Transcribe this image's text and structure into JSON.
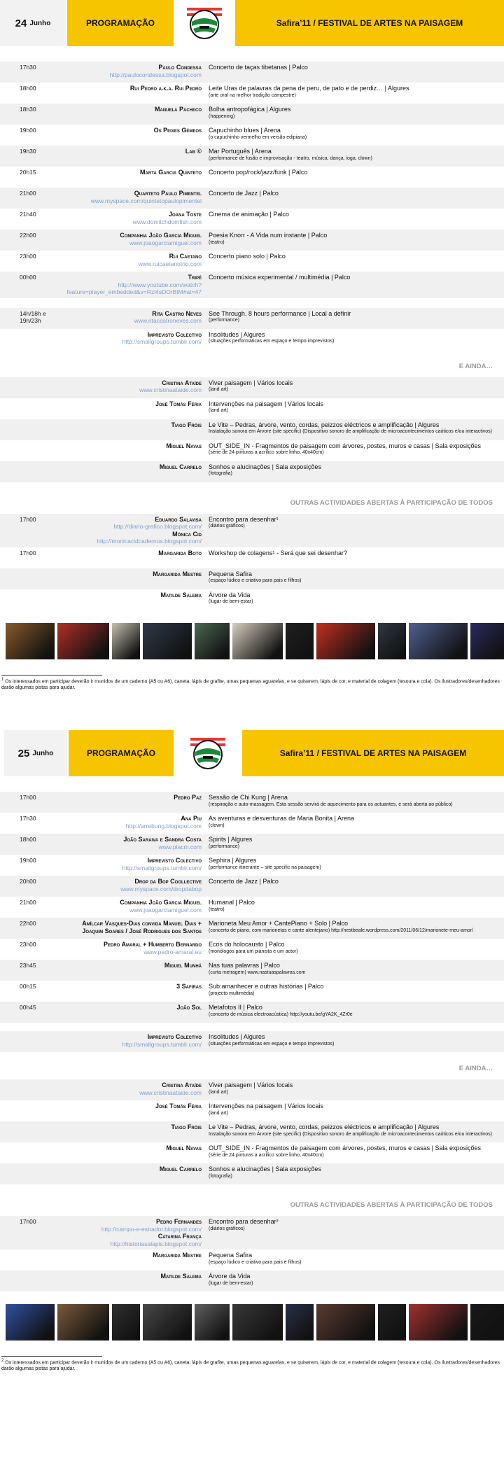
{
  "day1": {
    "date_num": "24",
    "date_month": "Junho",
    "programacao": "PROGRAMAÇÃO",
    "festival_title": "Safira’11 / FESTIVAL DE ARTES NA PAISAGEM",
    "schedule": [
      {
        "time": "17h30",
        "name": "Paulo Condessa",
        "link": "http://paulocondessa.blogspot.com",
        "act": "Concerto de taças tibetanas | Palco",
        "sub": ""
      },
      {
        "time": "18h00",
        "name": "Rui Pedro a.k.a. Rui Pedro",
        "link": "",
        "act": "Leite Uras de palavras da pena de peru, de pato e de perdiz… | Algures",
        "sub": "(arte oral na melhor tradição campestre)"
      },
      {
        "time": "18h30",
        "name": "Manuela Pacheco",
        "link": "",
        "act": "Bolha antropofágica | Algures",
        "sub": "(happening)"
      },
      {
        "time": "19h00",
        "name": "Os Peixes Gémeos",
        "link": "",
        "act": "Capuchinho blues | Arena",
        "sub": "(o capuchinho vermelho em versão edipiana)"
      },
      {
        "time": "19h30",
        "name": "Lab ©",
        "link": "",
        "act": "Mar Português | Arena",
        "sub": "(performance de fusão e improvisação - teatro, música, dança, ioga, clown)"
      },
      {
        "time": "20h15",
        "name": "Marta Garcia Quinteto",
        "link": "",
        "act": "Concerto pop/rock/jazz/funk | Palco",
        "sub": ""
      },
      {
        "time": "21h00",
        "name": "Quarteto Paulo Pimentel",
        "link": "www.myspace.com/quintetopaulopimentel",
        "act": "Concerto de Jazz | Palco",
        "sub": ""
      },
      {
        "time": "21h40",
        "name": "Joana Toste",
        "link": "www.domitchdomfish.com",
        "act": "Cinema de animação | Palco",
        "sub": ""
      },
      {
        "time": "22h00",
        "name": "Companhia João Garcia Miguel",
        "link": "www.joaogarciamiguel.com",
        "act": "Poesia Knorr - A Vida num instante | Palco",
        "sub": "(teatro)"
      },
      {
        "time": "23h00",
        "name": "Rui Caetano",
        "link": "www.ruicaetanotrio.com",
        "act": "Concerto piano solo | Palco",
        "sub": ""
      },
      {
        "time": "00h00",
        "name": "Tripé",
        "link": "http://www.youtube.com/watch?feature=player_embedded&v=Rzl4sDOrBtM#at=47",
        "act": "Concerto música experimental / multimédia | Palco",
        "sub": ""
      }
    ],
    "extra_rows": [
      {
        "time": "14h/18h e 19h/23h",
        "name": "Rita Castro Neves",
        "link": "www.ritacastroneves.com",
        "act": "See Through. 8 hours performance | Local a definir",
        "sub": "(performance)"
      },
      {
        "time": "",
        "name": "Imprevisto Colectivo",
        "link": "http://smallgroups.tumblr.com/",
        "act": "Insolitudes | Algures",
        "sub": "(situações performáticas em espaço e tempo imprevistos)"
      }
    ],
    "ainda_label": "E AINDA…",
    "ainda": [
      {
        "name": "Cristina Ataíde",
        "link": "www.cristinaataide.com",
        "act": "Viver paisagem | Vários locais",
        "sub": "(land art)"
      },
      {
        "name": "José Tomás Féria",
        "link": "",
        "act": "Intervenções na paisagem | Vários locais",
        "sub": "(land art)"
      },
      {
        "name": "Tiago Fróis",
        "link": "",
        "act": "Le Vite – Pedras, árvore, vento, cordas, peizzos eléctricos e amplificação | Algures",
        "sub": "Instalação sonora em Árvore (site specific) (Dispositivo sonoro de amplificação de microacontecimentos caóticos e/ou interactivos)"
      },
      {
        "name": "Miguel Navas",
        "link": "",
        "act": "OUT_SIDE_IN - Fragmentos de paisagem com árvores, postes, muros e casas | Sala exposições",
        "sub": "(série de 24 pinturas a acrílico sobre linho, 40x40cm)"
      },
      {
        "name": "Miguel Carrelo",
        "link": "",
        "act": "Sonhos e alucinações | Sala exposições",
        "sub": "(fotografia)"
      }
    ],
    "outras_label": "OUTRAS ACTIVIDADES ABERTAS À PARTICIPAÇÃO DE TODOS",
    "outras": [
      {
        "time": "17h00",
        "name": "Eduardo Salavisa",
        "link": "http://diario-grafico.blogspot.com/",
        "name2": "Mónica Cid",
        "link2": "http://monicacidcadernos.blogspot.com/",
        "act": "Encontro para desenhar¹",
        "sub": "(diários gráficos)"
      },
      {
        "time": "17h00",
        "name": "Margarida Boto",
        "link": "",
        "name2": "",
        "link2": "",
        "act": "Workshop de colagens¹ - Será que sei desenhar?",
        "sub": ""
      },
      {
        "time": "",
        "name": "Margarida Mestre",
        "link": "",
        "name2": "",
        "link2": "",
        "act": "Pequena Safira",
        "sub": "(espaço lúdico e criativo para pais e filhos)"
      },
      {
        "time": "",
        "name": "Matilde Salema",
        "link": "",
        "name2": "",
        "link2": "",
        "act": "Árvore da Vida",
        "sub": "(lugar de bem-estar)"
      }
    ],
    "footnote": "Os interessados em participar deverão ir munidos de um caderno (A5 ou A6), caneta, lápis de grafite, umas pequenas aguarelas, e se quiserem, lápis de cor, e material de colagem (tesoura e cola). Os ilustradores/desenhadores darão algumas pistas para ajudar."
  },
  "day2": {
    "date_num": "25",
    "date_month": "Junho",
    "programacao": "PROGRAMAÇÃO",
    "festival_title": "Safira’11 / FESTIVAL DE ARTES NA PAISAGEM",
    "schedule": [
      {
        "time": "17h00",
        "name": "Pedro Paz",
        "link": "",
        "act": "Sessão de Chi Kung | Arena",
        "sub": "(respiração e auto-massagem. Esta sessão servirá de aquecimento para os actuantes, e será aberta ao público)"
      },
      {
        "time": "17h30",
        "name": "Ana Piu",
        "link": "http://arrebung.blogspot.com",
        "act": "As aventuras e desventuras de Maria Bonita | Arena",
        "sub": "(clown)"
      },
      {
        "time": "18h00",
        "name": "João Saraiva e Sandra Costa",
        "link": "www.placm.com",
        "act": "Spirits | Algures",
        "sub": "(performance)"
      },
      {
        "time": "19h00",
        "name": "Imprevisto Colectivo",
        "link": "http://smallgroups.tumblr.com/",
        "act": "Sephira | Algures",
        "sub": "(performance itinerante – site specific na paisagem)"
      },
      {
        "time": "20h00",
        "name": "Drop da Bop Coollective",
        "link": "www.myspace.com/dropdabop",
        "act": "Concerto de Jazz | Palco",
        "sub": ""
      },
      {
        "time": "21h00",
        "name": "Companhia João Garcia Miguel",
        "link": "www.joaogarciamiguel.com",
        "act": "Humanal | Palco",
        "sub": "(teatro)"
      },
      {
        "time": "22h00",
        "name": "Amílcar Vasques-Dias convida Manuel Dias + Joaquim Soares / José Rodrigues dos Santos",
        "link": "",
        "act": "Marioneta Meu Amor + CantePiano + Solo | Palco",
        "sub": "(concerto de piano, com marionetas e cante alentejano) http://nestbeale.wordpress.com/2011/06/12/marionete-meu-amor/"
      },
      {
        "time": "23h00",
        "name": "Pedro Amaral + Humberto Bernardo",
        "link": "www.pedro-amaral.eu",
        "act": "Ecos do holocausto | Palco",
        "sub": "(monólogos para um pianista e um actor)"
      },
      {
        "time": "23h45",
        "name": "Miguel Munhá",
        "link": "",
        "act": "Nas tuas palavras | Palco",
        "sub": "(curta metragem) www.nastuaspalavras.com"
      },
      {
        "time": "00h15",
        "name": "3 Safiras",
        "link": "",
        "act": "Sub:amanhecer e outras histórias | Palco",
        "sub": "(projecto multimédia)"
      },
      {
        "time": "00h45",
        "name": "João Sol",
        "link": "",
        "act": "Metafotos II | Palco",
        "sub": "(concerto de música electroacústica) http://youtu.be/gYA2K_4Zr0e"
      }
    ],
    "extra_rows": [
      {
        "time": "",
        "name": "Imprevisto Colectivo",
        "link": "http://smallgroups.tumblr.com/",
        "act": "Insolitudes | Algures",
        "sub": "(situações performáticas em espaço e tempo imprevistos)"
      }
    ],
    "ainda_label": "E AINDA…",
    "ainda": [
      {
        "name": "Cristina Ataíde",
        "link": "www.cristinaataide.com",
        "act": "Viver paisagem | Vários locais",
        "sub": "(land art)"
      },
      {
        "name": "José Tomás Féria",
        "link": "",
        "act": "Intervenções na paisagem | Vários locais",
        "sub": "(land art)"
      },
      {
        "name": "Tiago Fróis",
        "link": "",
        "act": "Le Vite – Pedras, árvore, vento, cordas, peizzos eléctricos e amplificação | Algures",
        "sub": "Instalação sonora em Árvore (site specific) (Dispositivo sonoro de amplificação de microacontecimentos caóticos e/ou interactivos)"
      },
      {
        "name": "Miguel Navas",
        "link": "",
        "act": "OUT_SIDE_IN - Fragmentos de paisagem com árvores, postes, muros e casas | Sala exposições",
        "sub": "(série de 24 pinturas a acrílico sobre linho, 40x40cm)"
      },
      {
        "name": "Miguel Carrelo",
        "link": "",
        "act": "Sonhos e alucinações | Sala exposições",
        "sub": "(fotografia)"
      }
    ],
    "outras_label": "OUTRAS ACTIVIDADES ABERTAS À PARTICIPAÇÃO DE TODOS",
    "outras": [
      {
        "time": "17h00",
        "name": "Pedro Fernandes",
        "link": "http://campo-e-estrador.blogspot.com/",
        "name2": "Catarina França",
        "link2": "http://historiasalapis.blogspot.com/",
        "act": "Encontro para desenhar²",
        "sub": "(diários gráficos)"
      },
      {
        "time": "",
        "name": "Margarida Mestre",
        "link": "",
        "name2": "",
        "link2": "",
        "act": "Pequena Safira",
        "sub": "(espaço lúdico e criativo para pais e filhos)"
      },
      {
        "time": "",
        "name": "Matilde Salema",
        "link": "",
        "name2": "",
        "link2": "",
        "act": "Árvore da Vida",
        "sub": "(lugar de bem-estar)"
      }
    ],
    "footnote": "Os interessados em participar deverão ir munidos de um caderno (A5 ou A6), caneta, lápis de grafite, umas pequenas aguarelas, e se quiserem, lápis de cor, e material de colagem (tesoura e cola). Os ilustradores/desenhadores darão algumas pistas para ajudar."
  },
  "footnote_marks": {
    "day1": "1",
    "day2": "2"
  },
  "photo_colors": {
    "day1": [
      "#8a5a2a",
      "#b03028",
      "#c8c0b0",
      "#2e3a48",
      "#4a6a50",
      "#d8d0c0",
      "#202020",
      "#c03020",
      "#303840",
      "#506090",
      "#2a2a60"
    ],
    "day2": [
      "#3050a0",
      "#7a5a3a",
      "#303030",
      "#484848",
      "#606060",
      "#383838",
      "#283048",
      "#5a3a30",
      "#202020",
      "#a03030",
      "#181818"
    ]
  }
}
